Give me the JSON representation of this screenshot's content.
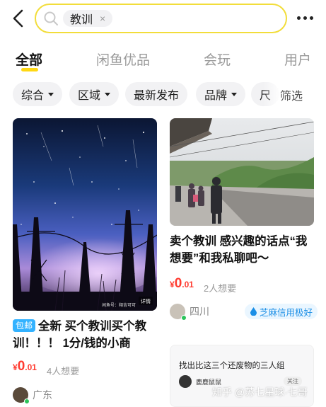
{
  "search": {
    "keyword": "教训",
    "clear_icon": "×"
  },
  "tabs": [
    {
      "label": "全部",
      "active": true
    },
    {
      "label": "闲鱼优品",
      "active": false
    },
    {
      "label": "会玩",
      "active": false
    },
    {
      "label": "用户",
      "active": false
    }
  ],
  "filters": {
    "items": [
      {
        "label": "综合",
        "dropdown": true
      },
      {
        "label": "区域",
        "dropdown": true
      },
      {
        "label": "最新发布",
        "dropdown": false
      },
      {
        "label": "品牌",
        "dropdown": true
      },
      {
        "label": "尺",
        "dropdown": false
      }
    ],
    "filter_button": "筛选"
  },
  "cards": [
    {
      "image_tag": "闲鱼号：翔吉可可",
      "image_badge": "详情",
      "badge": "包邮",
      "title": "全新  买个教训买个教训！！！ 1分/钱的小商",
      "price_currency": "¥",
      "price_int": "0",
      "price_dec": ".01",
      "wants": "4人想要",
      "location": "广东",
      "image_theme": "starry-night-transmission-towers"
    },
    {
      "title": "卖个教训 感兴趣的话点“我想要”和我私聊吧～",
      "price_currency": "¥",
      "price_int": "0",
      "price_dec": ".01",
      "wants": "2人想要",
      "location": "四川",
      "credit": "芝麻信用极好",
      "image_theme": "train-station-platform"
    },
    {
      "image_text_title": "找出比这三个还废物的三人组",
      "image_text_user": "鹿鹿鼠鼠",
      "image_text_follow": "关注"
    }
  ],
  "watermark": "知乎 @苏七星球·七哥",
  "colors": {
    "accent_yellow": "#ffd814",
    "search_border": "#f2dd3a",
    "price_red": "#ff3b30",
    "badge_blue": "#33b2ff",
    "credit_blue": "#1a8ee6"
  }
}
